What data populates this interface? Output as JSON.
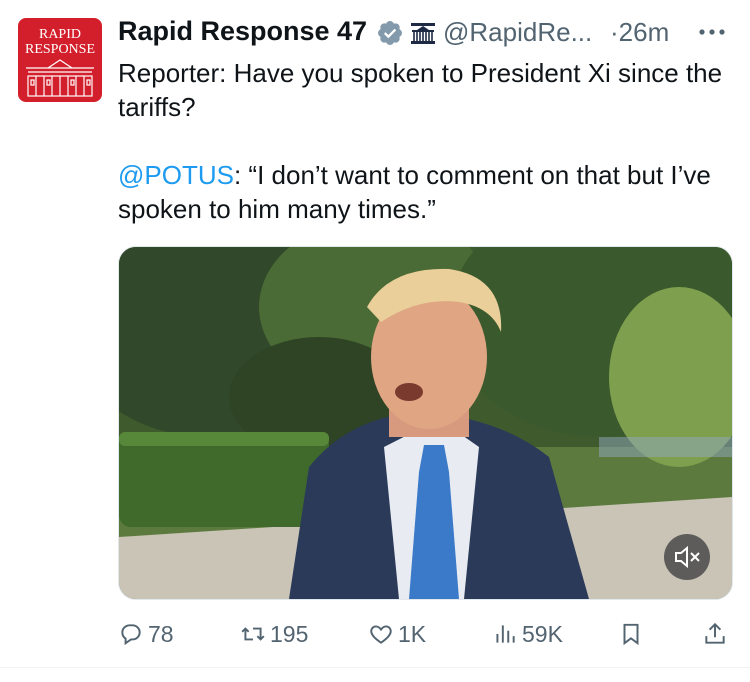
{
  "tweet": {
    "avatar_text_line1": "RAPID",
    "avatar_text_line2": "RESPONSE",
    "author_name": "Rapid Response 47",
    "handle": "@RapidRe...",
    "separator": "·",
    "timestamp": "26m",
    "text_line1": "Reporter: Have you spoken to President Xi since the tariffs?",
    "mention": "@POTUS",
    "quote": ": “I don’t want to comment on that but I’ve spoken to him many times.”"
  },
  "actions": {
    "replies": "78",
    "reposts": "195",
    "likes": "1K",
    "views": "59K"
  },
  "icons": [
    "verified-badge-icon",
    "government-badge-icon",
    "more-icon",
    "mute-icon",
    "reply-icon",
    "repost-icon",
    "like-icon",
    "views-icon",
    "bookmark-icon",
    "share-icon"
  ],
  "colors": {
    "accent": "#1d9bf0",
    "avatar_bg": "#d31f2b",
    "muted_text": "#536471"
  }
}
